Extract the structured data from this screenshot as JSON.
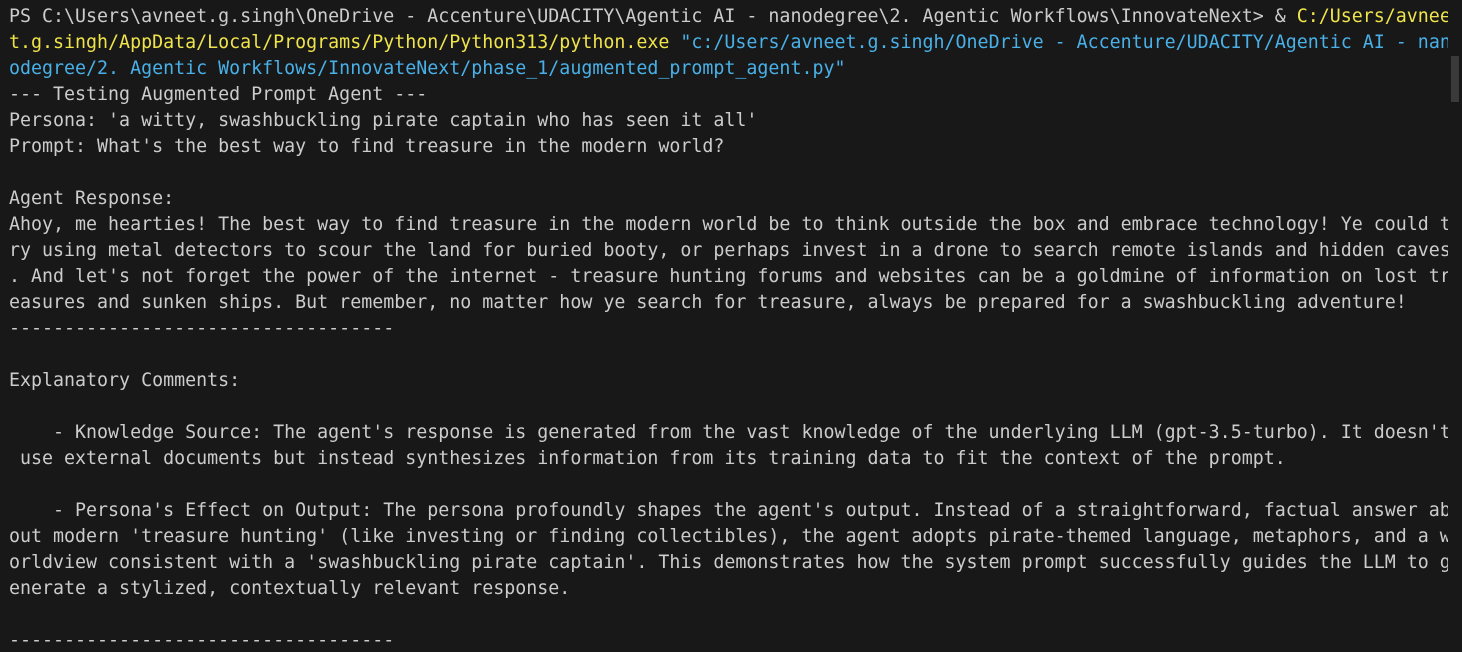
{
  "terminal": {
    "colors": {
      "background": "#181818",
      "text": "#cccccc",
      "path": "#f0e44b",
      "string": "#49b1e8"
    },
    "command": {
      "line1_prompt": "PS C:\\Users\\avneet.g.singh\\OneDrive - Accenture\\UDACITY\\Agentic AI - nanodegree\\2. Agentic Workflows\\InnovateNext> & ",
      "line1_exe": "C:/Users/avnee",
      "line2_exe": "t.g.singh/AppData/Local/Programs/Python/Python313/python.exe",
      "line2_space": " ",
      "line2_script": "\"c:/Users/avneet.g.singh/OneDrive - Accenture/UDACITY/Agentic AI - nan",
      "line3_script": "odegree/2. Agentic Workflows/InnovateNext/phase_1/augmented_prompt_agent.py\""
    },
    "output": [
      "--- Testing Augmented Prompt Agent ---",
      "Persona: 'a witty, swashbuckling pirate captain who has seen it all'",
      "Prompt: What's the best way to find treasure in the modern world?",
      "",
      "Agent Response:",
      "Ahoy, me hearties! The best way to find treasure in the modern world be to think outside the box and embrace technology! Ye could t",
      "ry using metal detectors to scour the land for buried booty, or perhaps invest in a drone to search remote islands and hidden caves",
      ". And let's not forget the power of the internet - treasure hunting forums and websites can be a goldmine of information on lost tr",
      "easures and sunken ships. But remember, no matter how ye search for treasure, always be prepared for a swashbuckling adventure!",
      "-----------------------------------",
      "",
      "Explanatory Comments:",
      "",
      "    - Knowledge Source: The agent's response is generated from the vast knowledge of the underlying LLM (gpt-3.5-turbo). It doesn't",
      " use external documents but instead synthesizes information from its training data to fit the context of the prompt.",
      "",
      "    - Persona's Effect on Output: The persona profoundly shapes the agent's output. Instead of a straightforward, factual answer ab",
      "out modern 'treasure hunting' (like investing or finding collectibles), the agent adopts pirate-themed language, metaphors, and a w",
      "orldview consistent with a 'swashbuckling pirate captain'. This demonstrates how the system prompt successfully guides the LLM to g",
      "enerate a stylized, contextually relevant response.",
      "",
      "-----------------------------------"
    ]
  }
}
